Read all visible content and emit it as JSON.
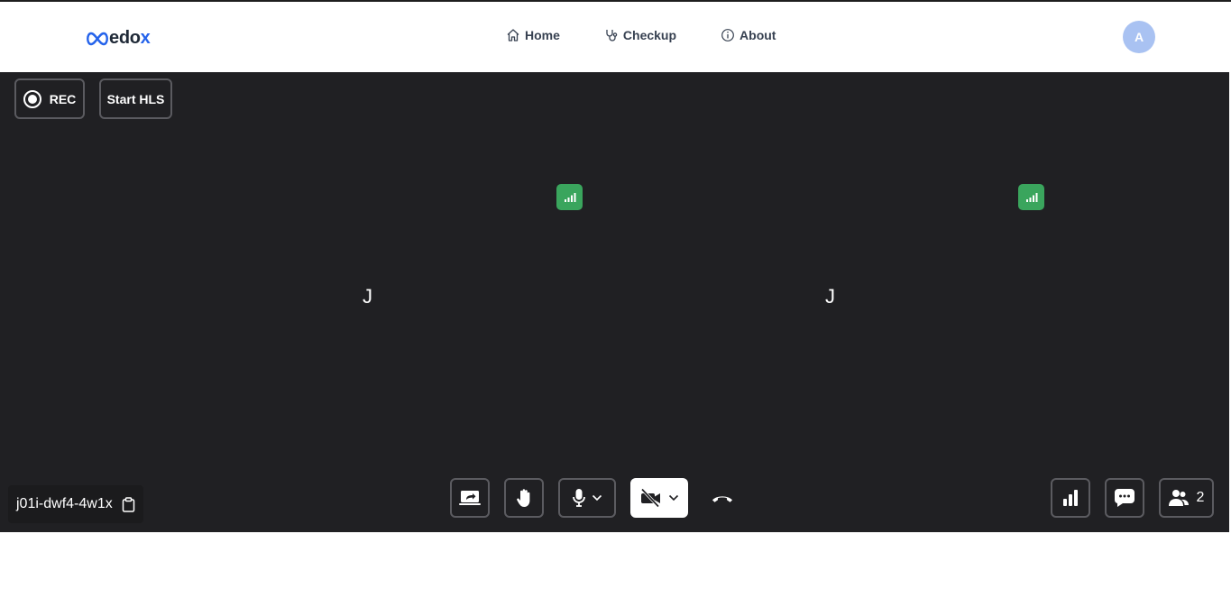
{
  "brand": {
    "logo_main": "edo",
    "logo_accent": "x",
    "accent_color": "#2563eb"
  },
  "nav": {
    "items": [
      {
        "label": "Home",
        "icon": "home-icon"
      },
      {
        "label": "Checkup",
        "icon": "stethoscope-icon"
      },
      {
        "label": "About",
        "icon": "info-icon"
      }
    ]
  },
  "user": {
    "avatar_initial": "A"
  },
  "meeting": {
    "rec_label": "REC",
    "hls_label": "Start HLS",
    "meeting_id": "j01i-dwf4-4w1x",
    "participants": [
      {
        "initial": "J",
        "signal_icon": "signal-bars-icon",
        "signal_color": "#3aa55d"
      },
      {
        "initial": "J",
        "signal_icon": "signal-bars-icon",
        "signal_color": "#3aa55d"
      }
    ],
    "participant_count": "2",
    "controls": {
      "screen_share_icon": "screen-share-icon",
      "raise_hand_icon": "raise-hand-icon",
      "mic_icon": "microphone-icon",
      "camera_icon": "camera-off-icon",
      "leave_icon": "phone-hangup-icon",
      "stats_icon": "bar-chart-icon",
      "chat_icon": "chat-bubble-icon",
      "people_icon": "people-icon"
    },
    "background_color": "#202023"
  }
}
